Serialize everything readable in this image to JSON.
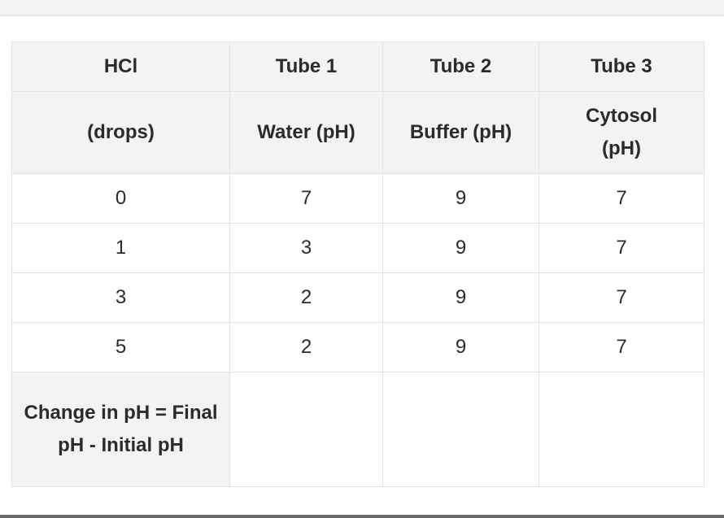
{
  "table": {
    "header": [
      "HCl",
      "Tube 1",
      "Tube 2",
      "Tube 3"
    ],
    "subheader": [
      "(drops)",
      "Water (pH)",
      "Buffer (pH)",
      "Cytosol (pH)"
    ],
    "rows": [
      [
        "0",
        "7",
        "9",
        "7"
      ],
      [
        "1",
        "3",
        "9",
        "7"
      ],
      [
        "3",
        "2",
        "9",
        "7"
      ],
      [
        "5",
        "2",
        "9",
        "7"
      ]
    ],
    "footer": [
      "Change in pH = Final pH - Initial pH",
      "",
      "",
      ""
    ]
  }
}
